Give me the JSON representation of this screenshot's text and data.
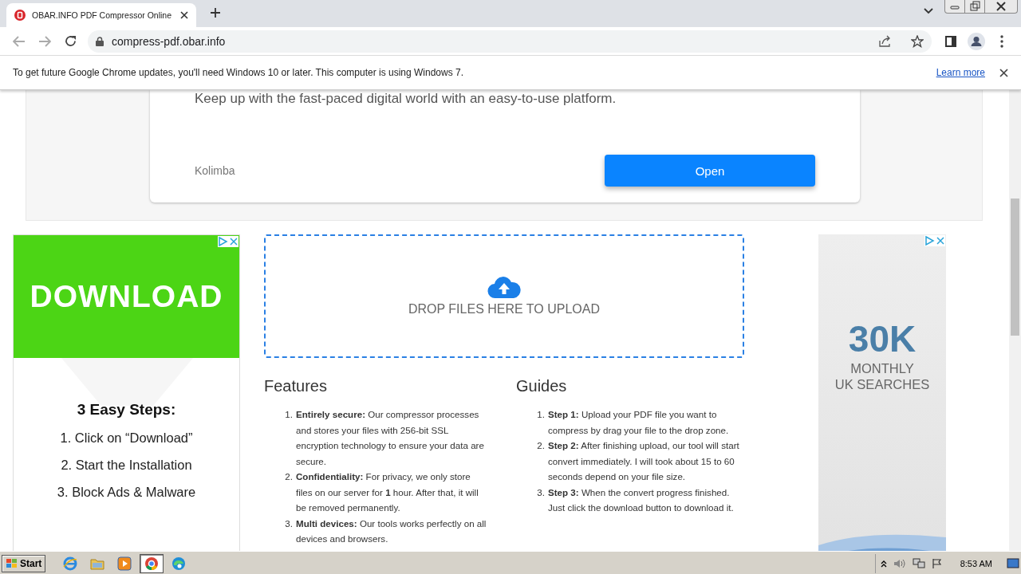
{
  "browser": {
    "tab": {
      "title": "OBAR.INFO PDF Compressor Online",
      "selected": true
    },
    "url": "compress-pdf.obar.info",
    "infobar": {
      "message": "To get future Google Chrome updates, you'll need Windows 10 or later. This computer is using Windows 7.",
      "link": "Learn more"
    }
  },
  "ad_card": {
    "tagline": "Keep up with the fast-paced digital world with an easy-to-use platform.",
    "brand": "Kolimba",
    "button": "Open"
  },
  "left_ad": {
    "headline": "DOWNLOAD",
    "steps_title": "3 Easy Steps:",
    "steps": [
      "1. Click on “Download”",
      "2. Start the Installation",
      "3. Block Ads & Malware"
    ]
  },
  "upload": {
    "label": "DROP FILES HERE TO UPLOAD"
  },
  "features": {
    "title": "Features",
    "items": [
      {
        "number": "1.",
        "text": "**Entirely secure:** Our compressor processes and stores your files with 256-bit SSL encryption technology to ensure your data are secure."
      },
      {
        "number": "2.",
        "text": "**Confidentiality:** For privacy, we only store files on our server for **1** hour. After that, it will be removed permanently."
      },
      {
        "number": "3.",
        "text": "**Multi devices:** Our tools works perfectly on all devices and browsers."
      }
    ]
  },
  "guides": {
    "title": "Guides",
    "items": [
      {
        "number": "1.",
        "text": "**Step 1:** Upload your PDF file you want to compress by drag your file to the drop zone."
      },
      {
        "number": "2.",
        "text": "**Step 2:** After finishing upload, our tool will start convert immediately. I will took about 15 to 60 seconds depend on your file size."
      },
      {
        "number": "3.",
        "text": "**Step 3:** When the convert progress finished. Just click the download button to download it."
      }
    ]
  },
  "right_ad": {
    "figure": "30K",
    "lines": [
      "MONTHLY",
      "UK SEARCHES"
    ]
  },
  "taskbar": {
    "start": "Start",
    "apps": [
      {
        "kind": "ie",
        "selected": false
      },
      {
        "kind": "folder",
        "selected": false
      },
      {
        "kind": "media",
        "selected": false
      },
      {
        "kind": "chrome",
        "selected": true
      },
      {
        "kind": "edge",
        "selected": false
      }
    ],
    "clock": "8:53 AM"
  }
}
